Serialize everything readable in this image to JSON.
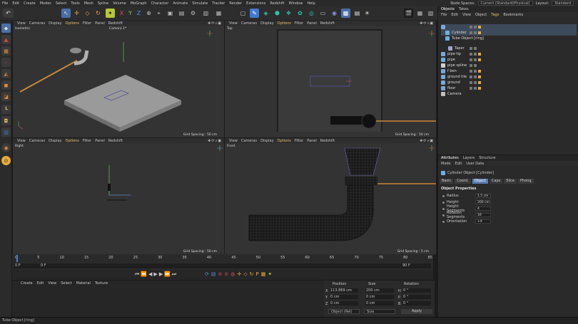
{
  "menu": {
    "items": [
      "File",
      "Edit",
      "Create",
      "Modes",
      "Select",
      "Tools",
      "Mesh",
      "Spline",
      "Volume",
      "MoGraph",
      "Character",
      "Animate",
      "Simulate",
      "Tracker",
      "Render",
      "Extensions",
      "Redshift",
      "Window",
      "Help"
    ],
    "node_spaces_label": "Node Spaces:",
    "node_spaces_value": "Current (Standard/Physical)",
    "layout_label": "Layout:",
    "layout_value": "Standard"
  },
  "viewports": {
    "menu": [
      "View",
      "Cameras",
      "Display",
      "Options",
      "Filter",
      "Panel",
      "Redshift"
    ],
    "active_menu": "Options",
    "perspective": {
      "label": "Isometric",
      "camera": "Camera 1*",
      "grid": "Grid Spacing : 50 cm"
    },
    "top": {
      "label": "Top",
      "grid": "Grid Spacing : 50 cm"
    },
    "right": {
      "label": "Right",
      "grid": "Grid Spacing : 50 cm"
    },
    "front": {
      "label": "Front",
      "grid": "Grid Spacing : 5 cm"
    }
  },
  "timeline": {
    "ticks": [
      "0",
      "5",
      "10",
      "15",
      "20",
      "25",
      "30",
      "35",
      "40",
      "45",
      "50",
      "55",
      "60",
      "65",
      "70",
      "75",
      "80",
      "85"
    ],
    "start_frame": "0 F",
    "current_frame": "0 F",
    "end_frame": "90 F"
  },
  "material_manager": {
    "menu": [
      "Create",
      "Edit",
      "View",
      "Select",
      "Material",
      "Texture"
    ]
  },
  "coordinates": {
    "headers": [
      "Position",
      "Size",
      "Rotation"
    ],
    "rows": [
      {
        "axis": "X",
        "pos": "113.869 cm",
        "size": "200 cm",
        "rot_axis": "H",
        "rot": "0 °"
      },
      {
        "axis": "Y",
        "pos": "0 cm",
        "size": "0 cm",
        "rot_axis": "P",
        "rot": "0 °"
      },
      {
        "axis": "Z",
        "pos": "0 cm",
        "size": "0 cm",
        "rot_axis": "B",
        "rot": "0 °"
      }
    ],
    "mode_1": "Object (Rel)",
    "mode_2": "Size",
    "apply": "Apply"
  },
  "status": "Tube Object [ring]",
  "object_manager": {
    "tabs": [
      "Objects",
      "Takes"
    ],
    "menu": [
      "File",
      "Edit",
      "View",
      "Object",
      "Tags",
      "Bookmarks"
    ],
    "active_menu": "Tags",
    "objects": [
      {
        "name": "",
        "color": "#7aa7d8"
      },
      {
        "name": "Cylinder",
        "color": "#6cb0e0"
      },
      {
        "name": "Tube Object [ring]",
        "color": "#6cb0e0"
      },
      {
        "name": "Taper",
        "color": "#9fa4d6"
      },
      {
        "name": "pipe tip",
        "color": "#7aa7d8"
      },
      {
        "name": "pipe",
        "color": "#6cb0e0"
      },
      {
        "name": "pipe spline",
        "color": "#d0d0d0"
      },
      {
        "name": "f ben",
        "color": "#7aa7d8"
      },
      {
        "name": "ground tile",
        "color": "#7aa7d8"
      },
      {
        "name": "ground",
        "color": "#7aa7d8"
      },
      {
        "name": "floor",
        "color": "#7aa7d8"
      },
      {
        "name": "Camera",
        "color": "#c0c0c0"
      }
    ]
  },
  "attributes": {
    "tabs": [
      "Attributes",
      "Layers",
      "Structure"
    ],
    "menu": [
      "Mode",
      "Edit",
      "User Data"
    ],
    "title": "Cylinder Object [Cylinder]",
    "subtabs": [
      "Basic",
      "Coord.",
      "Object",
      "Caps",
      "Slice",
      "Phong"
    ],
    "active_subtab": "Object",
    "section": "Object Properties",
    "props": [
      {
        "label": "Radius",
        "value": "1.5 cm"
      },
      {
        "label": "Height",
        "value": "200 cm"
      },
      {
        "label": "Height Segments",
        "value": "4"
      },
      {
        "label": "Rotation Segments",
        "value": "16"
      },
      {
        "label": "Orientation",
        "value": "+X"
      }
    ]
  },
  "colors": {
    "accent": "#e8c16a",
    "selection": "#5a7db0",
    "viewport_bg": "#333333"
  }
}
